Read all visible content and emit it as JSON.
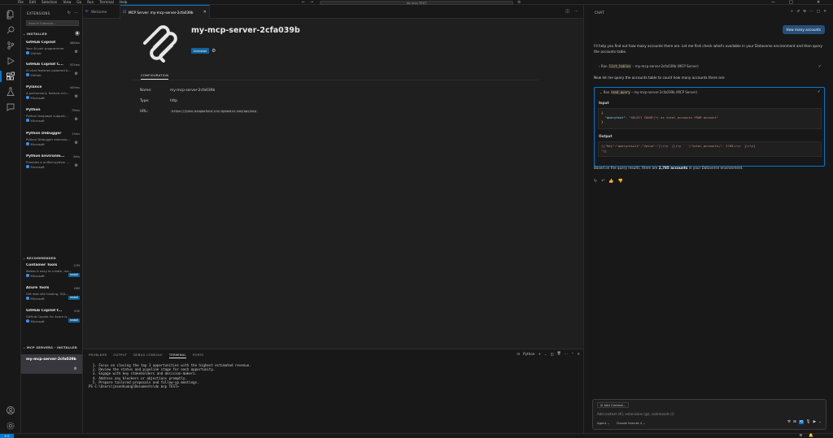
{
  "titlebar": {
    "menu": [
      "File",
      "Edit",
      "Selection",
      "View",
      "Go",
      "Run",
      "Terminal",
      "Help"
    ],
    "search": "do mcp TEST",
    "back": "←",
    "forward": "→",
    "win_min": "—",
    "win_max": "□",
    "win_close": "✕"
  },
  "sidebar": {
    "title": "EXTENSIONS",
    "search_placeholder": "Search Extensio...",
    "installed_header": "INSTALLED",
    "installed_count": "6",
    "installed": [
      {
        "name": "GitHub Copilot",
        "downloads": "468ms",
        "desc": "Your AI pair programmer",
        "publisher": "GitHub"
      },
      {
        "name": "GitHub Copilot C...",
        "downloads": "925ms",
        "desc": "AI chat features powered b...",
        "publisher": "GitHub"
      },
      {
        "name": "Pylance",
        "downloads": "449ms",
        "desc": "A performant, feature-rich...",
        "publisher": "Microsoft"
      },
      {
        "name": "Python",
        "downloads": "78ms",
        "desc": "Python language support...",
        "publisher": "Microsoft"
      },
      {
        "name": "Python Debugger",
        "downloads": "13ms",
        "desc": "Python Debugger extensio...",
        "publisher": "Microsoft"
      },
      {
        "name": "Python Environm...",
        "downloads": "8ms",
        "desc": "Provides a unified python ...",
        "publisher": "Microsoft"
      }
    ],
    "recommended_header": "RECOMMENDED",
    "recommended": [
      {
        "name": "Container Tools",
        "downloads": "27M",
        "desc": "Makes it easy to create, ma...",
        "publisher": "Microsoft",
        "action": "Install"
      },
      {
        "name": "Azure Tools",
        "downloads": "18M",
        "desc": "Get web site hosting, SQL...",
        "publisher": "Microsoft",
        "action": "Install"
      },
      {
        "name": "GitHub Copilot f...",
        "downloads": "50K",
        "desc": "GitHub Copilot for Azure is...",
        "publisher": "Microsoft",
        "action": "Install"
      }
    ],
    "mcp_header": "MCP SERVERS - INSTALLED",
    "mcp_item": "my-mcp-server-2cfa039b"
  },
  "tabs": [
    {
      "label": "Welcome"
    },
    {
      "label": "MCP Server: my-mcp-server-2cfa039b"
    }
  ],
  "editor": {
    "title": "my-mcp-server-2cfa039b",
    "uninstall": "Uninstall",
    "config_tab": "CONFIGURATION",
    "rows": [
      {
        "key": "Name:",
        "value": "my-mcp-server-2cfa039b"
      },
      {
        "key": "Type:",
        "value": "http"
      },
      {
        "key": "URL:",
        "value": "https://yasu-azagoofund.crm.dynamics.com/api/mcp"
      }
    ]
  },
  "panel": {
    "tabs": [
      "PROBLEMS",
      "OUTPUT",
      "DEBUG CONSOLE",
      "TERMINAL",
      "PORTS"
    ],
    "terminal_label": "Python",
    "lines": [
      "  1. Focus on closing the top 3 opportunities with the highest estimated revenue.",
      "  2. Review the status and pipeline stage for each opportunity.",
      "  3. Engage with key stakeholders and decision-makers.",
      "  4. Address any blockers or objections promptly.",
      "  5. Prepare tailored proposals and follow-up meetings.",
      "PS C:\\Users\\jasonhuang\\Documents\\do mcp TEST>"
    ]
  },
  "chat": {
    "title": "CHAT",
    "user_msg": "How many accounts",
    "intro": "I'll help you find out how many accounts there are. Let me first check what's available in your Dataverse environment and then query the accounts table.",
    "tool1_pre": "Ran",
    "tool1_code": "list_tables",
    "tool1_post": "– my-mcp-server-2cfa039b (MCP Server)",
    "msg2": "Now let me query the accounts table to count how many accounts there are:",
    "tool2_pre": "Ran",
    "tool2_code": "read_query",
    "tool2_post": "– my-mcp-server-2cfa039b (MCP Server)",
    "input_label": "Input",
    "input_code_key": "\"querytext\"",
    "input_code_val": "\"SELECT COUNT(*) as total_accounts FROM account\"",
    "output_label": "Output",
    "output_line1": "[{\"Key\":\"queryresult\",\"Value\":\"[\\r\\n  {\\r\\n    \\\"total_accounts\\\": 2785\\r\\n  }\\r\\n]",
    "output_line2": "\"}]",
    "result_pre": "Based on the query results, there are ",
    "result_bold": "2,785 accounts",
    "result_post": " in your Dataverse environment.",
    "add_context": "Add Context...",
    "placeholder": "Add context (#), extensions (@), commands (/)",
    "mode": "Agent",
    "model": "Claude Sonnet 4"
  },
  "statusbar": {
    "remote": "><"
  }
}
